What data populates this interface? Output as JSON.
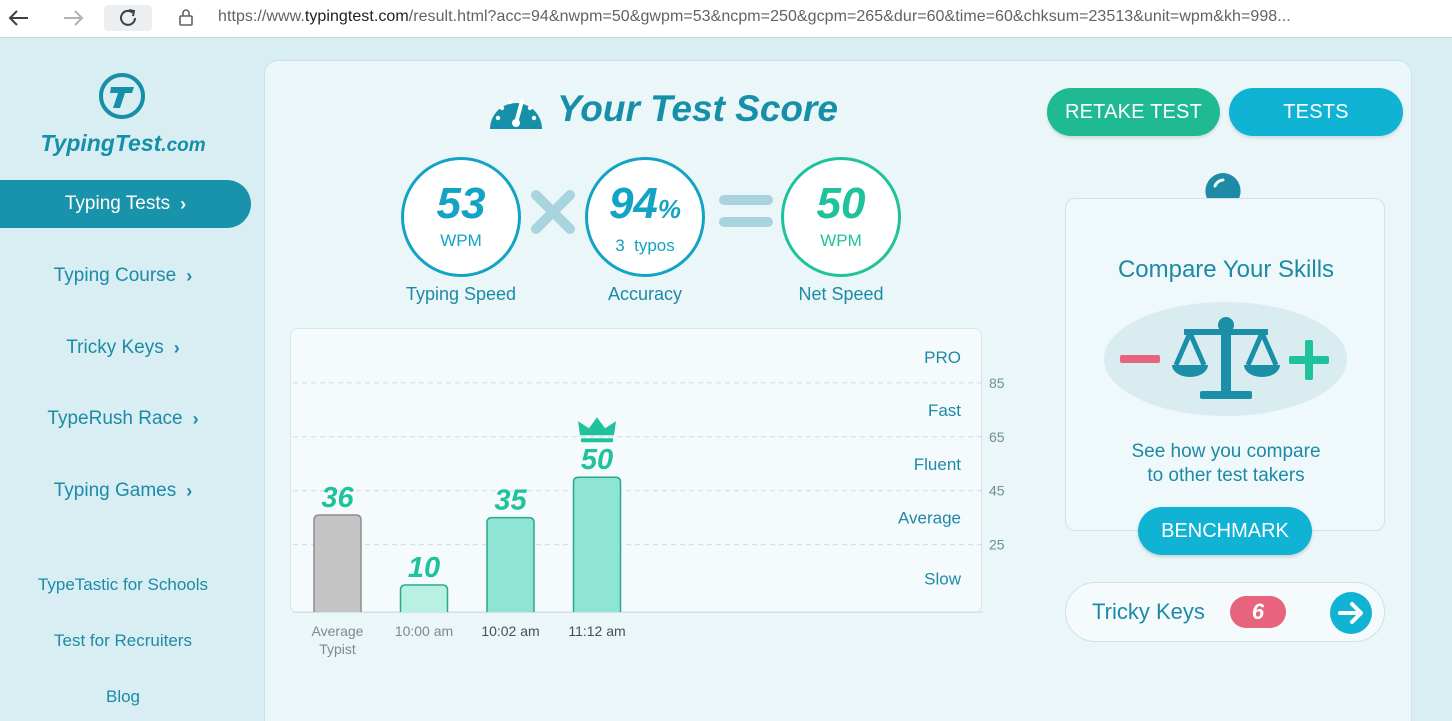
{
  "browser": {
    "url_prefix": "https://www.",
    "url_host": "typingtest.com",
    "url_rest": "/result.html?acc=94&nwpm=50&gwpm=53&ncpm=250&gcpm=265&dur=60&time=60&chksum=23513&unit=wpm&kh=998..."
  },
  "logo": {
    "name": "TypingTest",
    "suffix": ".com"
  },
  "sidebar": {
    "nav": [
      {
        "label": "Typing Tests",
        "active": true
      },
      {
        "label": "Typing Course",
        "active": false
      },
      {
        "label": "Tricky Keys",
        "active": false
      },
      {
        "label": "TypeRush Race",
        "active": false
      },
      {
        "label": "Typing Games",
        "active": false
      }
    ],
    "chevron": "›",
    "links": [
      "TypeTastic for Schools",
      "Test for Recruiters",
      "Blog"
    ]
  },
  "header": {
    "title": "Your Test Score",
    "retake_label": "RETAKE TEST",
    "tests_label": "TESTS"
  },
  "metrics": {
    "speed": {
      "value": "53",
      "unit": "WPM",
      "label": "Typing Speed"
    },
    "accuracy": {
      "value": "94",
      "pct": "%",
      "sub": "3  typos",
      "label": "Accuracy"
    },
    "net": {
      "value": "50",
      "unit": "WPM",
      "label": "Net Speed"
    }
  },
  "chart_data": {
    "type": "bar",
    "categories": [
      "Average Typist",
      "10:00 am",
      "10:02 am",
      "11:12 am"
    ],
    "category_lines": [
      [
        "Average",
        "Typist"
      ],
      [
        "10:00 am"
      ],
      [
        "10:02 am"
      ],
      [
        "11:12 am"
      ]
    ],
    "values": [
      36,
      10,
      35,
      50
    ],
    "value_labels": [
      "36",
      "10",
      "35",
      "50"
    ],
    "ylim": [
      0,
      105
    ],
    "gridlines": [
      25,
      45,
      65,
      85
    ],
    "right_tick_labels": [
      "85",
      "65",
      "45",
      "25"
    ],
    "levels": [
      "PRO",
      "Fast",
      "Fluent",
      "Average",
      "Slow"
    ],
    "highlight_index": 3,
    "colors": {
      "average": "#c4c4c4",
      "past": "#b8f0e1",
      "recent": "#8ee5d3",
      "best": "#8ee5d3",
      "bar_stroke": "#2aa88d",
      "value_label": "#20c29b",
      "crown": "#20c29b"
    }
  },
  "compare": {
    "title": "Compare Your Skills",
    "line1": "See how you compare",
    "line2": "to other test takers",
    "button": "BENCHMARK"
  },
  "tricky": {
    "label": "Tricky Keys",
    "count": "6"
  },
  "colors": {
    "primary": "#1993ab",
    "teal": "#13a3c4",
    "green": "#20c29b",
    "cyan_button": "#11b3d5",
    "red": "#e8637c"
  },
  "icons": [
    "back-arrow-icon",
    "forward-arrow-icon",
    "reload-icon",
    "lock-icon",
    "gauge-icon",
    "times-icon",
    "equals-icon",
    "lightbulb-icon",
    "scale-icon",
    "minus-icon",
    "plus-icon",
    "arrow-right-icon",
    "crown-icon"
  ]
}
